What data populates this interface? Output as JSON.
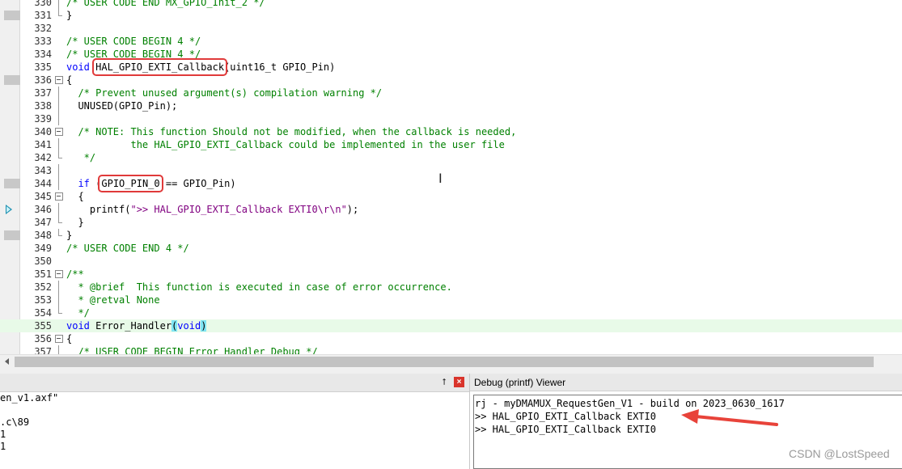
{
  "editor": {
    "lines": [
      {
        "num": "330",
        "marker": false,
        "fold": "vline",
        "segments": [
          [
            "c",
            "/* USER CODE END MX_GPIO_Init_2 */"
          ]
        ]
      },
      {
        "num": "331",
        "marker": true,
        "fold": "end",
        "segments": [
          [
            "",
            "}"
          ]
        ]
      },
      {
        "num": "332",
        "marker": false,
        "fold": "",
        "segments": []
      },
      {
        "num": "333",
        "marker": false,
        "fold": "",
        "segments": [
          [
            "c",
            "/* USER CODE BEGIN 4 */"
          ]
        ]
      },
      {
        "num": "334",
        "marker": false,
        "fold": "",
        "segments": [
          [
            "c",
            "/* USER CODE BEGIN 4 */"
          ]
        ]
      },
      {
        "num": "335",
        "marker": false,
        "fold": "",
        "segments": [
          [
            "k",
            "void "
          ],
          [
            "hl",
            "HAL_GPIO_EXTI_Callback"
          ],
          [
            "",
            "(uint16_t GPIO_Pin)"
          ]
        ]
      },
      {
        "num": "336",
        "marker": true,
        "fold": "box",
        "segments": [
          [
            "",
            "{"
          ]
        ]
      },
      {
        "num": "337",
        "marker": false,
        "fold": "vline",
        "segments": [
          [
            "",
            "  "
          ],
          [
            "c",
            "/* Prevent unused argument(s) compilation warning */"
          ]
        ]
      },
      {
        "num": "338",
        "marker": false,
        "fold": "vline",
        "segments": [
          [
            "",
            "  UNUSED(GPIO_Pin);"
          ]
        ]
      },
      {
        "num": "339",
        "marker": false,
        "fold": "vline",
        "segments": []
      },
      {
        "num": "340",
        "marker": false,
        "fold": "box",
        "segments": [
          [
            "",
            "  "
          ],
          [
            "c",
            "/* NOTE: This function Should not be modified, when the callback is needed,"
          ]
        ]
      },
      {
        "num": "341",
        "marker": false,
        "fold": "vline",
        "segments": [
          [
            "c",
            "           the HAL_GPIO_EXTI_Callback could be implemented in the user file"
          ]
        ]
      },
      {
        "num": "342",
        "marker": false,
        "fold": "end",
        "segments": [
          [
            "c",
            "   */"
          ]
        ]
      },
      {
        "num": "343",
        "marker": false,
        "fold": "vline",
        "segments": []
      },
      {
        "num": "344",
        "marker": true,
        "fold": "vline",
        "segments": [
          [
            "",
            "  "
          ],
          [
            "k",
            "if "
          ],
          [
            "",
            "("
          ],
          [
            "hl",
            "GPIO_PIN_0"
          ],
          [
            "",
            " == GPIO_Pin)"
          ]
        ]
      },
      {
        "num": "345",
        "marker": false,
        "fold": "box",
        "segments": [
          [
            "",
            "  {"
          ]
        ]
      },
      {
        "num": "346",
        "marker": false,
        "arrow": true,
        "fold": "vline",
        "segments": [
          [
            "",
            "    printf("
          ],
          [
            "s",
            "\">> HAL_GPIO_EXTI_Callback EXTI0\\r\\n\""
          ],
          [
            "",
            ");"
          ]
        ]
      },
      {
        "num": "347",
        "marker": false,
        "fold": "end",
        "segments": [
          [
            "",
            "  }"
          ]
        ]
      },
      {
        "num": "348",
        "marker": true,
        "fold": "end",
        "segments": [
          [
            "",
            "}"
          ]
        ]
      },
      {
        "num": "349",
        "marker": false,
        "fold": "",
        "segments": [
          [
            "c",
            "/* USER CODE END 4 */"
          ]
        ]
      },
      {
        "num": "350",
        "marker": false,
        "fold": "",
        "segments": []
      },
      {
        "num": "351",
        "marker": false,
        "fold": "box",
        "segments": [
          [
            "c",
            "/**"
          ]
        ]
      },
      {
        "num": "352",
        "marker": false,
        "fold": "vline",
        "segments": [
          [
            "c",
            "  * @brief  This function is executed in case of error occurrence."
          ]
        ]
      },
      {
        "num": "353",
        "marker": false,
        "fold": "vline",
        "segments": [
          [
            "c",
            "  * @retval None"
          ]
        ]
      },
      {
        "num": "354",
        "marker": false,
        "fold": "end",
        "segments": [
          [
            "c",
            "  */"
          ]
        ]
      },
      {
        "num": "355",
        "marker": false,
        "fold": "",
        "current": true,
        "segments": [
          [
            "k",
            "void "
          ],
          [
            "",
            "Error_Handler"
          ],
          [
            "p",
            "("
          ],
          [
            "k",
            "void"
          ],
          [
            "p",
            ")"
          ]
        ]
      },
      {
        "num": "356",
        "marker": false,
        "fold": "box",
        "segments": [
          [
            "",
            "{"
          ]
        ]
      },
      {
        "num": "357",
        "marker": false,
        "fold": "vline",
        "segments": [
          [
            "",
            "  "
          ],
          [
            "c",
            "/* USER CODE BEGIN Error_Handler_Debug */"
          ]
        ]
      }
    ]
  },
  "build_output": {
    "pin_icon": "⭡",
    "close_icon": "×",
    "lines": [
      "en_v1.axf\"",
      "",
      ".c\\89",
      "1",
      "1"
    ]
  },
  "debug_viewer": {
    "title": "Debug (printf) Viewer",
    "lines": [
      "rj - myDMAMUX_RequestGen_V1 - build on 2023_0630_1617",
      ">> HAL_GPIO_EXTI_Callback EXTI0",
      ">> HAL_GPIO_EXTI_Callback EXTI0"
    ]
  },
  "watermark": "CSDN @LostSpeed",
  "colors": {
    "comment": "#008000",
    "keyword": "#0000ff",
    "string": "#800080",
    "highlight_box": "#e03a3a",
    "current_line": "#e8fae8",
    "paren_match": "#7fe6f5"
  }
}
